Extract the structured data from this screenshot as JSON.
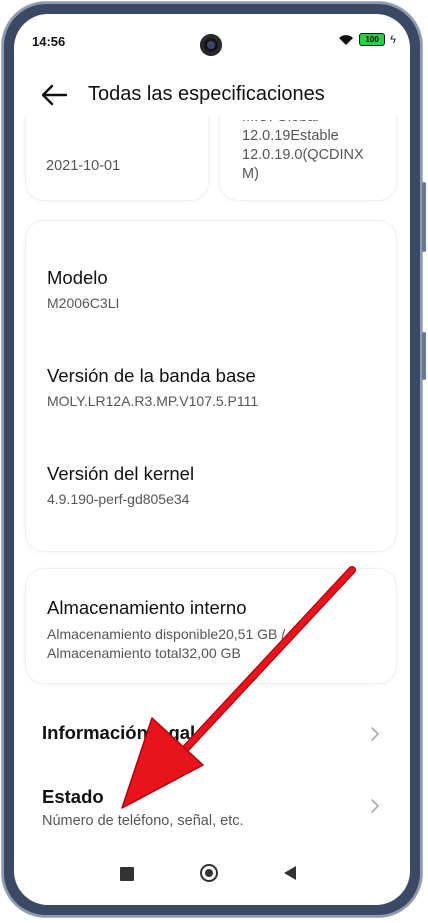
{
  "status_bar": {
    "time": "14:56",
    "battery_level": "100",
    "icons": [
      "camera-icon",
      "wifi-icon",
      "battery-icon",
      "charging-icon"
    ]
  },
  "header": {
    "title": "Todas las especificaciones",
    "back_icon": "arrow-left-icon"
  },
  "top_cards": {
    "left_value": "2021-10-01",
    "right_value_lines": [
      "MIUI Global",
      "12.0.19Estable",
      "12.0.19.0(QCDINX",
      "M)"
    ]
  },
  "device_specs": [
    {
      "label": "Modelo",
      "value": "M2006C3LI"
    },
    {
      "label": "Versión de la banda base",
      "value": "MOLY.LR12A.R3.MP.V107.5.P111"
    },
    {
      "label": "Versión del kernel",
      "value": "4.9.190-perf-gd805e34"
    }
  ],
  "storage": {
    "label": "Almacenamiento interno",
    "value": "Almacenamiento disponible20,51 GB / Almacenamiento total32,00 GB"
  },
  "list_rows": [
    {
      "title": "Información legal",
      "subtitle": ""
    },
    {
      "title": "Estado",
      "subtitle": "Número de teléfono, señal, etc."
    }
  ],
  "colors": {
    "background": "#ffffff",
    "frame": "#3b4a64",
    "annotation_arrow": "#e8141c",
    "battery": "#2ecc40"
  }
}
